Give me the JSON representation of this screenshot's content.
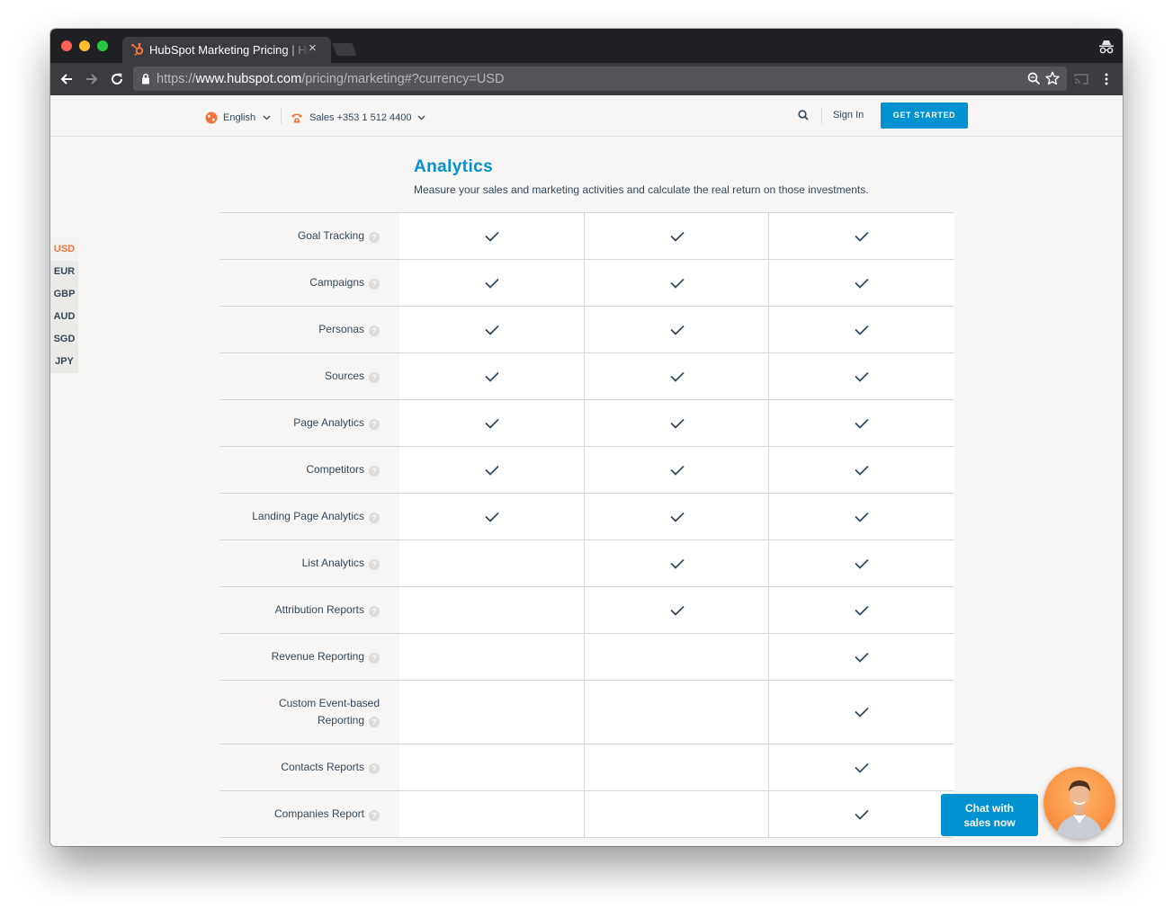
{
  "browser": {
    "tab_title": "HubSpot Marketing Pricing | HubSpot",
    "tab_close": "×",
    "url_scheme": "https://",
    "url_host": "www.hubspot.com",
    "url_rest": "/pricing/marketing#?currency=USD"
  },
  "nav": {
    "language": "English",
    "sales": "Sales +353 1 512 4400",
    "sign_in": "Sign In",
    "get_started": "GET STARTED"
  },
  "currencies": [
    "USD",
    "EUR",
    "GBP",
    "AUD",
    "SGD",
    "JPY"
  ],
  "selected_currency": "USD",
  "section": {
    "title": "Analytics",
    "description": "Measure your sales and marketing activities and calculate the real return on those investments."
  },
  "features": [
    {
      "label": "Goal Tracking",
      "included": [
        true,
        true,
        true
      ]
    },
    {
      "label": "Campaigns",
      "included": [
        true,
        true,
        true
      ]
    },
    {
      "label": "Personas",
      "included": [
        true,
        true,
        true
      ]
    },
    {
      "label": "Sources",
      "included": [
        true,
        true,
        true
      ]
    },
    {
      "label": "Page Analytics",
      "included": [
        true,
        true,
        true
      ]
    },
    {
      "label": "Competitors",
      "included": [
        true,
        true,
        true
      ]
    },
    {
      "label": "Landing Page Analytics",
      "included": [
        true,
        true,
        true
      ]
    },
    {
      "label": "List Analytics",
      "included": [
        false,
        true,
        true
      ]
    },
    {
      "label": "Attribution Reports",
      "included": [
        false,
        true,
        true
      ]
    },
    {
      "label": "Revenue Reporting",
      "included": [
        false,
        false,
        true
      ]
    },
    {
      "label": "Custom Event-based Reporting",
      "included": [
        false,
        false,
        true
      ]
    },
    {
      "label": "Contacts Reports",
      "included": [
        false,
        false,
        true
      ]
    },
    {
      "label": "Companies Report",
      "included": [
        false,
        false,
        true
      ]
    }
  ],
  "help_icon": "?",
  "chat": {
    "line1": "Chat with",
    "line2": "sales now"
  },
  "colors": {
    "accent": "#0091d0",
    "brand_orange": "#f2743a",
    "text": "#33475b"
  }
}
